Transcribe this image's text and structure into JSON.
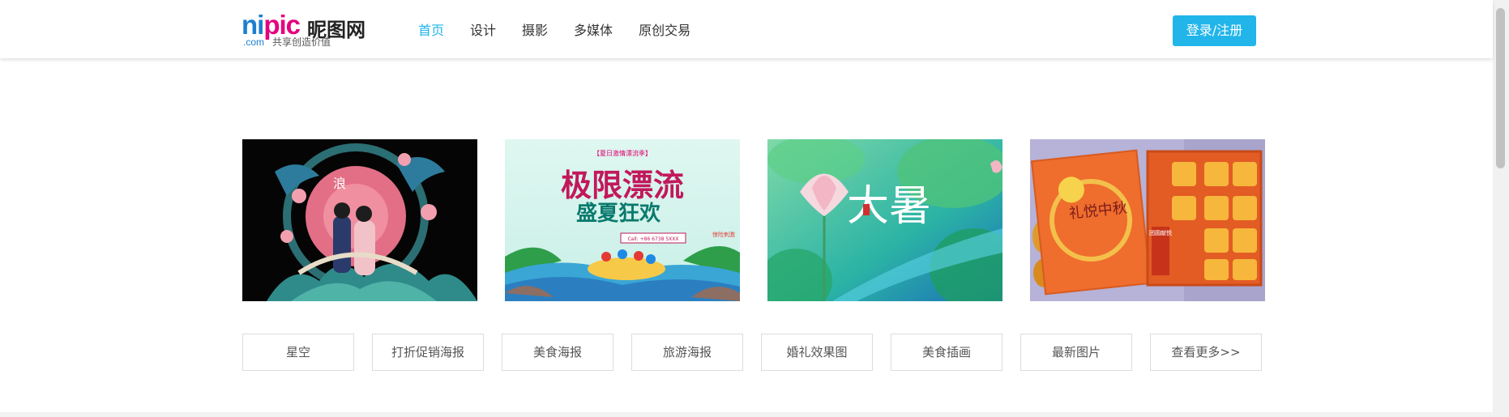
{
  "header": {
    "logo": {
      "word_a": "ni",
      "word_b": "pic",
      "name": "昵图网",
      "domain": ".com",
      "slogan": "共享创造价值"
    },
    "nav": [
      {
        "label": "首页",
        "active": true
      },
      {
        "label": "设计",
        "active": false
      },
      {
        "label": "摄影",
        "active": false
      },
      {
        "label": "多媒体",
        "active": false
      },
      {
        "label": "原创交易",
        "active": false
      }
    ],
    "login_label": "登录/注册"
  },
  "gallery": [
    {
      "id": "qixi-poster",
      "subject": "couple-on-bridge-illustration",
      "caption": ""
    },
    {
      "id": "rafting-poster",
      "headline": "极限漂流",
      "subline": "盛夏狂欢",
      "tag": "【夏日激情漂流季】",
      "phone": "Call: +86 6738 5XXX",
      "badge": "惊险刺激"
    },
    {
      "id": "dashu-poster",
      "headline": "大暑",
      "subject": "lotus-pond-illustration"
    },
    {
      "id": "mooncake-box",
      "headline": "礼悦中秋",
      "sub": "团圆献悦",
      "subject": "mooncake-gift-box"
    }
  ],
  "tags": [
    "星空",
    "打折促销海报",
    "美食海报",
    "旅游海报",
    "婚礼效果图",
    "美食插画",
    "最新图片",
    "查看更多>>"
  ],
  "colors": {
    "accent": "#21b5ea",
    "logo_blue": "#1c7fd0",
    "logo_pink": "#e4007e"
  }
}
